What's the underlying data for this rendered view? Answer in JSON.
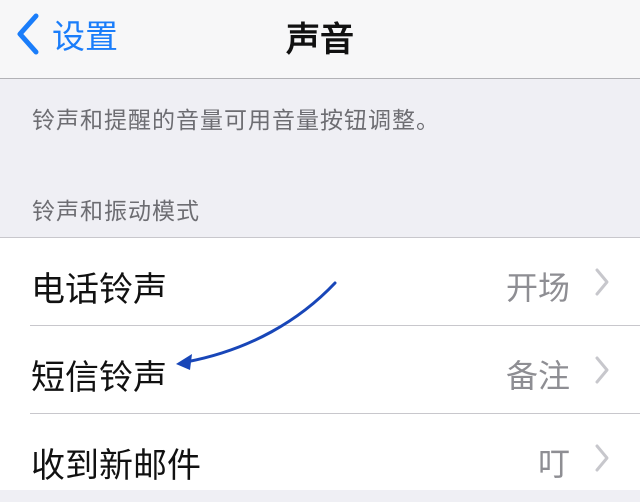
{
  "navbar": {
    "back_label": "设置",
    "title": "声音"
  },
  "note": "铃声和提醒的音量可用音量按钮调整。",
  "section_header": "铃声和振动模式",
  "rows": [
    {
      "label": "电话铃声",
      "value": "开场"
    },
    {
      "label": "短信铃声",
      "value": "备注"
    },
    {
      "label": "收到新邮件",
      "value": "叮"
    }
  ],
  "colors": {
    "accent": "#1a7dfa",
    "annotation_arrow": "#1846b8"
  },
  "icons": {
    "back": "chevron-left-icon",
    "disclosure": "chevron-right-icon"
  }
}
